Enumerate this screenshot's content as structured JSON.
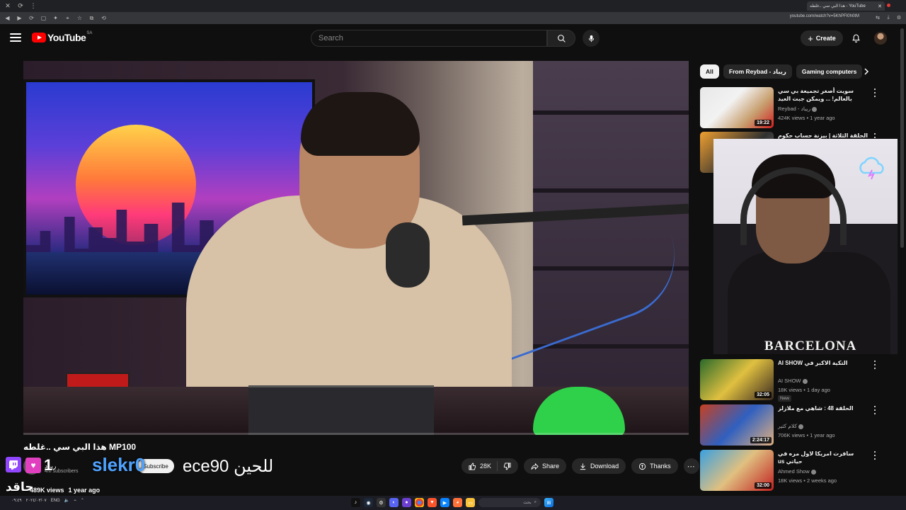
{
  "browser": {
    "tab_title": "هذا البي سي ..غلطه - YouTube",
    "url": "youtube.com/watch?v=5KhPFI0h0tM"
  },
  "header": {
    "logo_text": "YouTube",
    "country_code": "SA",
    "search_placeholder": "Search",
    "create_label": "Create"
  },
  "video": {
    "title": "MP100 هذا البي سي ..غلطه",
    "channel_name": "ريباد",
    "subscribers": "4M subscribers",
    "subscribe_label": "Subscribe",
    "views": "489K views",
    "age": "1 year ago",
    "progress": 0.0,
    "likes": "28K",
    "share_label": "Share",
    "download_label": "Download",
    "thanks_label": "Thanks"
  },
  "stream_overlay": {
    "name_text": "slekr0",
    "sub_text": "ece90 للحين",
    "badge_count": "1",
    "bottom_text": "حاقد",
    "webcam_shirt_text": "BARCELONA"
  },
  "sidebar": {
    "chips": [
      "All",
      "From Reybad - ريباد",
      "Gaming computers"
    ],
    "recommendations": [
      {
        "title": "سويت أصغر تجميعة بي سي بالعالم! ... ويمكن جبت العيد",
        "channel": "Reybad - ريباد",
        "views": "424K views",
        "age": "1 year ago",
        "duration": "19:22",
        "new": ""
      },
      {
        "title": "الحلقة الثلاثة | بيزنة حساب حكوم | PS5",
        "channel": "",
        "views": "",
        "age": "",
        "duration": "",
        "new": ""
      },
      {
        "title": "التكية الاكبر في AI SHOW",
        "channel": "AI SHOW",
        "views": "18K views",
        "age": "1 day ago",
        "duration": "32:05",
        "new": "New"
      },
      {
        "title": "الحلقة 48 : شاهي مع ملازلز",
        "channel": "كلام كثير",
        "views": "706K views",
        "age": "1 year ago",
        "duration": "2:24:17",
        "new": ""
      },
      {
        "title": "سافرت امريكا لاول مره في حياتي us",
        "channel": "Ahmed Show",
        "views": "18K views",
        "age": "2 weeks ago",
        "duration": "32:00",
        "new": ""
      }
    ]
  },
  "taskbar": {
    "search_text": "بحث",
    "lang": "ENG",
    "time": "٠٩:٤٩",
    "date": "٢٠٢٤/٠٣/٠٧"
  },
  "colors": {
    "brand_red": "#ff0000",
    "background": "#0f0f0f",
    "chip_bg": "#272727",
    "twitch": "#9146ff"
  }
}
